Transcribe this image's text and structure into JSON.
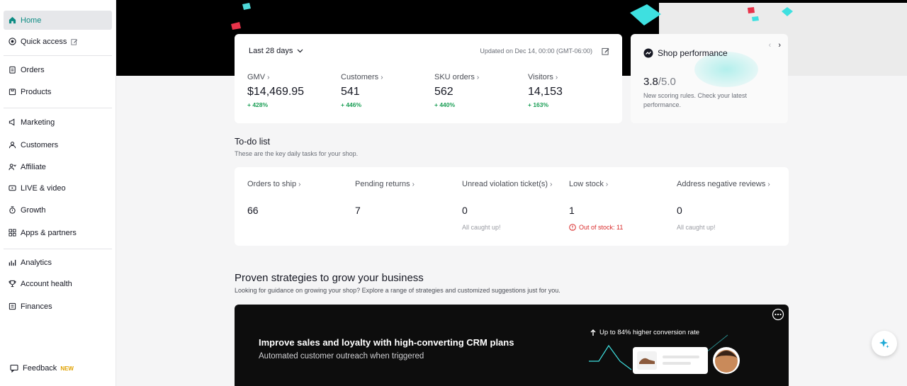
{
  "sidebar": {
    "items": [
      {
        "label": "Home",
        "icon": "home-icon"
      },
      {
        "label": "Quick access",
        "icon": "quick-access-icon"
      },
      {
        "label": "Orders",
        "icon": "orders-icon"
      },
      {
        "label": "Products",
        "icon": "products-icon"
      },
      {
        "label": "Marketing",
        "icon": "megaphone-icon"
      },
      {
        "label": "Customers",
        "icon": "customers-icon"
      },
      {
        "label": "Affiliate",
        "icon": "affiliate-icon"
      },
      {
        "label": "LIVE & video",
        "icon": "video-icon"
      },
      {
        "label": "Growth",
        "icon": "growth-icon"
      },
      {
        "label": "Apps & partners",
        "icon": "apps-icon"
      },
      {
        "label": "Analytics",
        "icon": "analytics-icon"
      },
      {
        "label": "Account health",
        "icon": "trophy-icon"
      },
      {
        "label": "Finances",
        "icon": "finances-icon"
      }
    ],
    "feedback": {
      "label": "Feedback",
      "badge": "NEW"
    }
  },
  "metrics": {
    "range": "Last 28 days",
    "updated": "Updated on Dec 14, 00:00 (GMT-06:00)",
    "items": [
      {
        "label": "GMV",
        "value": "$14,469.95",
        "change": "+ 428%"
      },
      {
        "label": "Customers",
        "value": "541",
        "change": "+ 446%"
      },
      {
        "label": "SKU orders",
        "value": "562",
        "change": "+ 440%"
      },
      {
        "label": "Visitors",
        "value": "14,153",
        "change": "+ 163%"
      }
    ]
  },
  "performance": {
    "title": "Shop performance",
    "score": "3.8",
    "max": "/5.0",
    "description": "New scoring rules. Check your latest performance."
  },
  "todo": {
    "title": "To-do list",
    "subtitle": "These are the key daily tasks for your shop.",
    "items": [
      {
        "label": "Orders to ship",
        "value": "66",
        "note": ""
      },
      {
        "label": "Pending returns",
        "value": "7",
        "note": ""
      },
      {
        "label": "Unread violation ticket(s)",
        "value": "0",
        "note": "All caught up!"
      },
      {
        "label": "Low stock",
        "value": "1",
        "note": "Out of stock: 11"
      },
      {
        "label": "Address negative reviews",
        "value": "0",
        "note": "All caught up!"
      }
    ]
  },
  "strategies": {
    "title": "Proven strategies to grow your business",
    "subtitle": "Looking for guidance on growing your shop? Explore a range of strategies and customized suggestions just for you.",
    "banner_title": "Improve sales and loyalty with high-converting CRM plans",
    "banner_sub": "Automated customer outreach when triggered",
    "banner_stat": "Up to 84% higher conversion rate"
  },
  "colors": {
    "accent": "#0e8c84",
    "positive": "#1a9e55",
    "warning": "#d92a2a"
  }
}
